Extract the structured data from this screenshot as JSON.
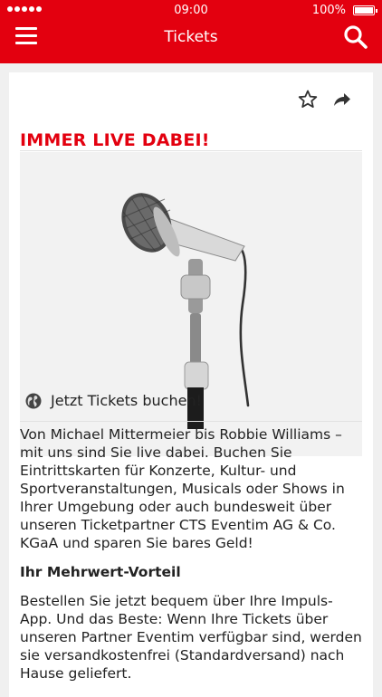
{
  "status_bar": {
    "time": "09:00",
    "battery": "100%"
  },
  "navbar": {
    "title": "Tickets",
    "menu_icon": "hamburger-menu-icon",
    "search_icon": "search-icon"
  },
  "article": {
    "headline": "IMMER LIVE DABEI!",
    "hero_image": "microphone-on-stand",
    "link_label": "Jetzt Tickets buchen!",
    "link_icon": "globe-icon",
    "intro": "Von Michael Mittermeier bis Robbie Williams – mit uns sind Sie live dabei. Buchen Sie Eintrittskarten für Konzerte, Kultur- und Sportveranstaltungen, Musicals oder Shows in Ihrer Umgebung oder auch bundesweit über unseren Ticketpartner CTS Eventim AG & Co. KGaA und sparen Sie bares Geld!",
    "subheading": "Ihr Mehrwert-Vorteil",
    "benefit": "Bestellen Sie jetzt bequem über Ihre Impuls-App. Und das Beste: Wenn Ihre Tickets über unseren Partner Eventim verfügbar sind, werden sie versandkostenfrei (Standardversand) nach Hause geliefert."
  },
  "colors": {
    "brand_red": "#e3000f"
  }
}
